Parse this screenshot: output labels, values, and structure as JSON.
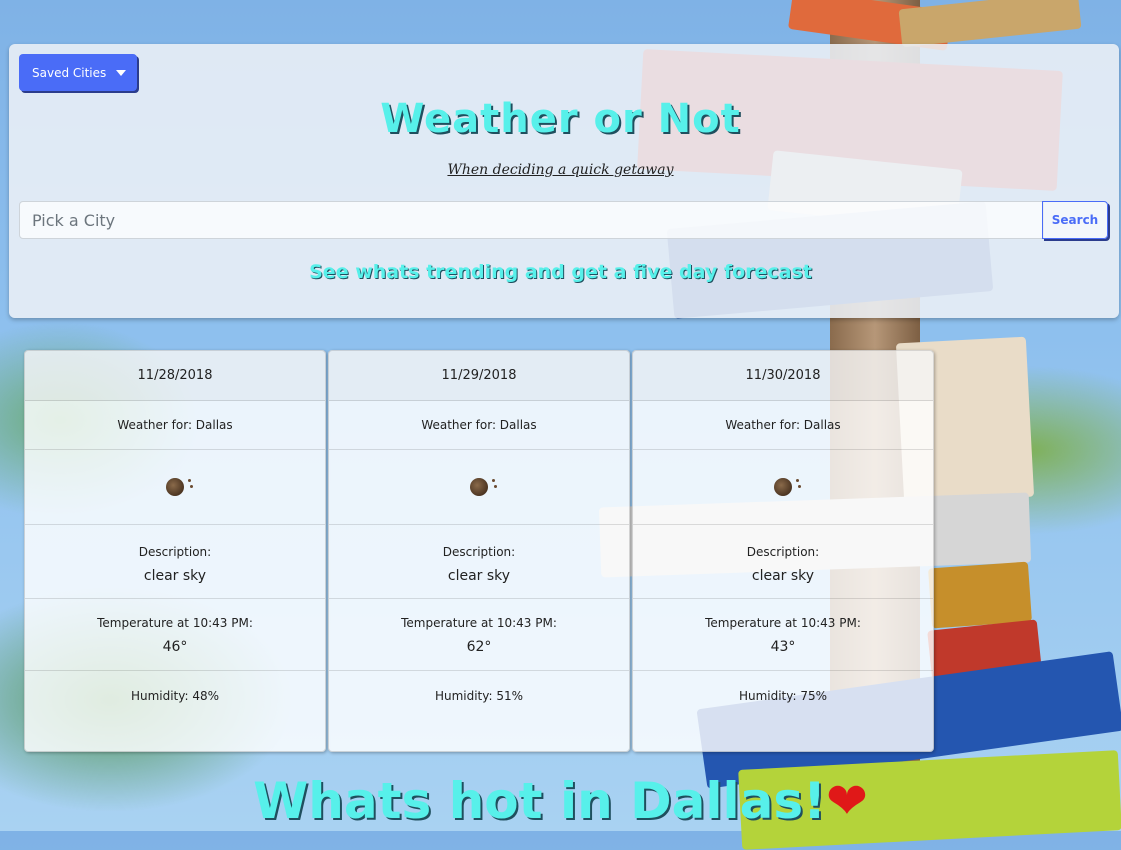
{
  "header": {
    "dropdown_label": "Saved Cities",
    "title": "Weather or Not",
    "subtitle": "When deciding a quick getaway",
    "search_placeholder": "Pick a City",
    "search_button": "Search",
    "tagline": "See whats trending and get a five day forecast"
  },
  "forecast": [
    {
      "date": "11/28/2018",
      "city": "Weather for: Dallas",
      "icon": "clear-night-icon",
      "desc_label": "Description:",
      "desc": "clear sky",
      "temp_label": "Temperature at 10:43 PM:",
      "temp": "46°",
      "humidity": "Humidity: 48%"
    },
    {
      "date": "11/29/2018",
      "city": "Weather for: Dallas",
      "icon": "clear-night-icon",
      "desc_label": "Description:",
      "desc": "clear sky",
      "temp_label": "Temperature at 10:43 PM:",
      "temp": "62°",
      "humidity": "Humidity: 51%"
    },
    {
      "date": "11/30/2018",
      "city": "Weather for: Dallas",
      "icon": "clear-night-icon",
      "desc_label": "Description:",
      "desc": "clear sky",
      "temp_label": "Temperature at 10:43 PM:",
      "temp": "43°",
      "humidity": "Humidity: 75%"
    }
  ],
  "footer": {
    "hot_text": "Whats hot in Dallas!",
    "heart": "❤"
  },
  "colors": {
    "accent": "#4a6cf7",
    "title": "#57f0ea"
  }
}
